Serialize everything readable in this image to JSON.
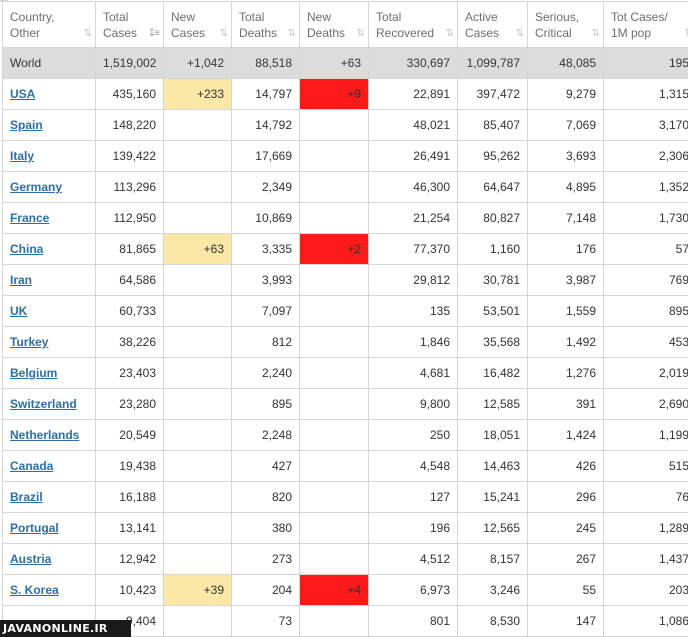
{
  "columns": [
    {
      "line1": "Country,",
      "line2": "Other",
      "sort_icon": "sort-icon",
      "active": false
    },
    {
      "line1": "Total",
      "line2": "Cases",
      "sort_icon": "sort-desc-icon",
      "active": true
    },
    {
      "line1": "New",
      "line2": "Cases",
      "sort_icon": "sort-icon",
      "active": false
    },
    {
      "line1": "Total",
      "line2": "Deaths",
      "sort_icon": "sort-icon",
      "active": false
    },
    {
      "line1": "New",
      "line2": "Deaths",
      "sort_icon": "sort-icon",
      "active": false
    },
    {
      "line1": "Total",
      "line2": "Recovered",
      "sort_icon": "sort-icon",
      "active": false
    },
    {
      "line1": "Active",
      "line2": "Cases",
      "sort_icon": "sort-icon",
      "active": false
    },
    {
      "line1": "Serious,",
      "line2": "Critical",
      "sort_icon": "sort-icon",
      "active": false
    },
    {
      "line1": "Tot Cases/",
      "line2": "1M pop",
      "sort_icon": "sort-icon",
      "active": false
    }
  ],
  "world": {
    "country": "World",
    "total_cases": "1,519,002",
    "new_cases": "+1,042",
    "total_deaths": "88,518",
    "new_deaths": "+63",
    "total_recovered": "330,697",
    "active_cases": "1,099,787",
    "serious_critical": "48,085",
    "cases_per_1m": "195"
  },
  "rows": [
    {
      "country": "USA",
      "total_cases": "435,160",
      "new_cases": "+233",
      "total_deaths": "14,797",
      "new_deaths": "+9",
      "total_recovered": "22,891",
      "active_cases": "397,472",
      "serious_critical": "9,279",
      "cases_per_1m": "1,315"
    },
    {
      "country": "Spain",
      "total_cases": "148,220",
      "new_cases": "",
      "total_deaths": "14,792",
      "new_deaths": "",
      "total_recovered": "48,021",
      "active_cases": "85,407",
      "serious_critical": "7,069",
      "cases_per_1m": "3,170"
    },
    {
      "country": "Italy",
      "total_cases": "139,422",
      "new_cases": "",
      "total_deaths": "17,669",
      "new_deaths": "",
      "total_recovered": "26,491",
      "active_cases": "95,262",
      "serious_critical": "3,693",
      "cases_per_1m": "2,306"
    },
    {
      "country": "Germany",
      "total_cases": "113,296",
      "new_cases": "",
      "total_deaths": "2,349",
      "new_deaths": "",
      "total_recovered": "46,300",
      "active_cases": "64,647",
      "serious_critical": "4,895",
      "cases_per_1m": "1,352"
    },
    {
      "country": "France",
      "total_cases": "112,950",
      "new_cases": "",
      "total_deaths": "10,869",
      "new_deaths": "",
      "total_recovered": "21,254",
      "active_cases": "80,827",
      "serious_critical": "7,148",
      "cases_per_1m": "1,730"
    },
    {
      "country": "China",
      "total_cases": "81,865",
      "new_cases": "+63",
      "total_deaths": "3,335",
      "new_deaths": "+2",
      "total_recovered": "77,370",
      "active_cases": "1,160",
      "serious_critical": "176",
      "cases_per_1m": "57"
    },
    {
      "country": "Iran",
      "total_cases": "64,586",
      "new_cases": "",
      "total_deaths": "3,993",
      "new_deaths": "",
      "total_recovered": "29,812",
      "active_cases": "30,781",
      "serious_critical": "3,987",
      "cases_per_1m": "769"
    },
    {
      "country": "UK",
      "total_cases": "60,733",
      "new_cases": "",
      "total_deaths": "7,097",
      "new_deaths": "",
      "total_recovered": "135",
      "active_cases": "53,501",
      "serious_critical": "1,559",
      "cases_per_1m": "895"
    },
    {
      "country": "Turkey",
      "total_cases": "38,226",
      "new_cases": "",
      "total_deaths": "812",
      "new_deaths": "",
      "total_recovered": "1,846",
      "active_cases": "35,568",
      "serious_critical": "1,492",
      "cases_per_1m": "453"
    },
    {
      "country": "Belgium",
      "total_cases": "23,403",
      "new_cases": "",
      "total_deaths": "2,240",
      "new_deaths": "",
      "total_recovered": "4,681",
      "active_cases": "16,482",
      "serious_critical": "1,276",
      "cases_per_1m": "2,019"
    },
    {
      "country": "Switzerland",
      "total_cases": "23,280",
      "new_cases": "",
      "total_deaths": "895",
      "new_deaths": "",
      "total_recovered": "9,800",
      "active_cases": "12,585",
      "serious_critical": "391",
      "cases_per_1m": "2,690"
    },
    {
      "country": "Netherlands",
      "total_cases": "20,549",
      "new_cases": "",
      "total_deaths": "2,248",
      "new_deaths": "",
      "total_recovered": "250",
      "active_cases": "18,051",
      "serious_critical": "1,424",
      "cases_per_1m": "1,199"
    },
    {
      "country": "Canada",
      "total_cases": "19,438",
      "new_cases": "",
      "total_deaths": "427",
      "new_deaths": "",
      "total_recovered": "4,548",
      "active_cases": "14,463",
      "serious_critical": "426",
      "cases_per_1m": "515"
    },
    {
      "country": "Brazil",
      "total_cases": "16,188",
      "new_cases": "",
      "total_deaths": "820",
      "new_deaths": "",
      "total_recovered": "127",
      "active_cases": "15,241",
      "serious_critical": "296",
      "cases_per_1m": "76"
    },
    {
      "country": "Portugal",
      "total_cases": "13,141",
      "new_cases": "",
      "total_deaths": "380",
      "new_deaths": "",
      "total_recovered": "196",
      "active_cases": "12,565",
      "serious_critical": "245",
      "cases_per_1m": "1,289"
    },
    {
      "country": "Austria",
      "total_cases": "12,942",
      "new_cases": "",
      "total_deaths": "273",
      "new_deaths": "",
      "total_recovered": "4,512",
      "active_cases": "8,157",
      "serious_critical": "267",
      "cases_per_1m": "1,437"
    },
    {
      "country": "S. Korea",
      "total_cases": "10,423",
      "new_cases": "+39",
      "total_deaths": "204",
      "new_deaths": "+4",
      "total_recovered": "6,973",
      "active_cases": "3,246",
      "serious_critical": "55",
      "cases_per_1m": "203"
    },
    {
      "country": "",
      "total_cases": "9,404",
      "new_cases": "",
      "total_deaths": "73",
      "new_deaths": "",
      "total_recovered": "801",
      "active_cases": "8,530",
      "serious_critical": "147",
      "cases_per_1m": "1,086"
    }
  ],
  "highlight_colors": {
    "new_cases": "#fbe8a6",
    "new_deaths": "#ff1a1a",
    "world_row": "#dcdcdc",
    "country_link": "#2d6ea8"
  },
  "watermark": "JAVANONLINE.IR"
}
